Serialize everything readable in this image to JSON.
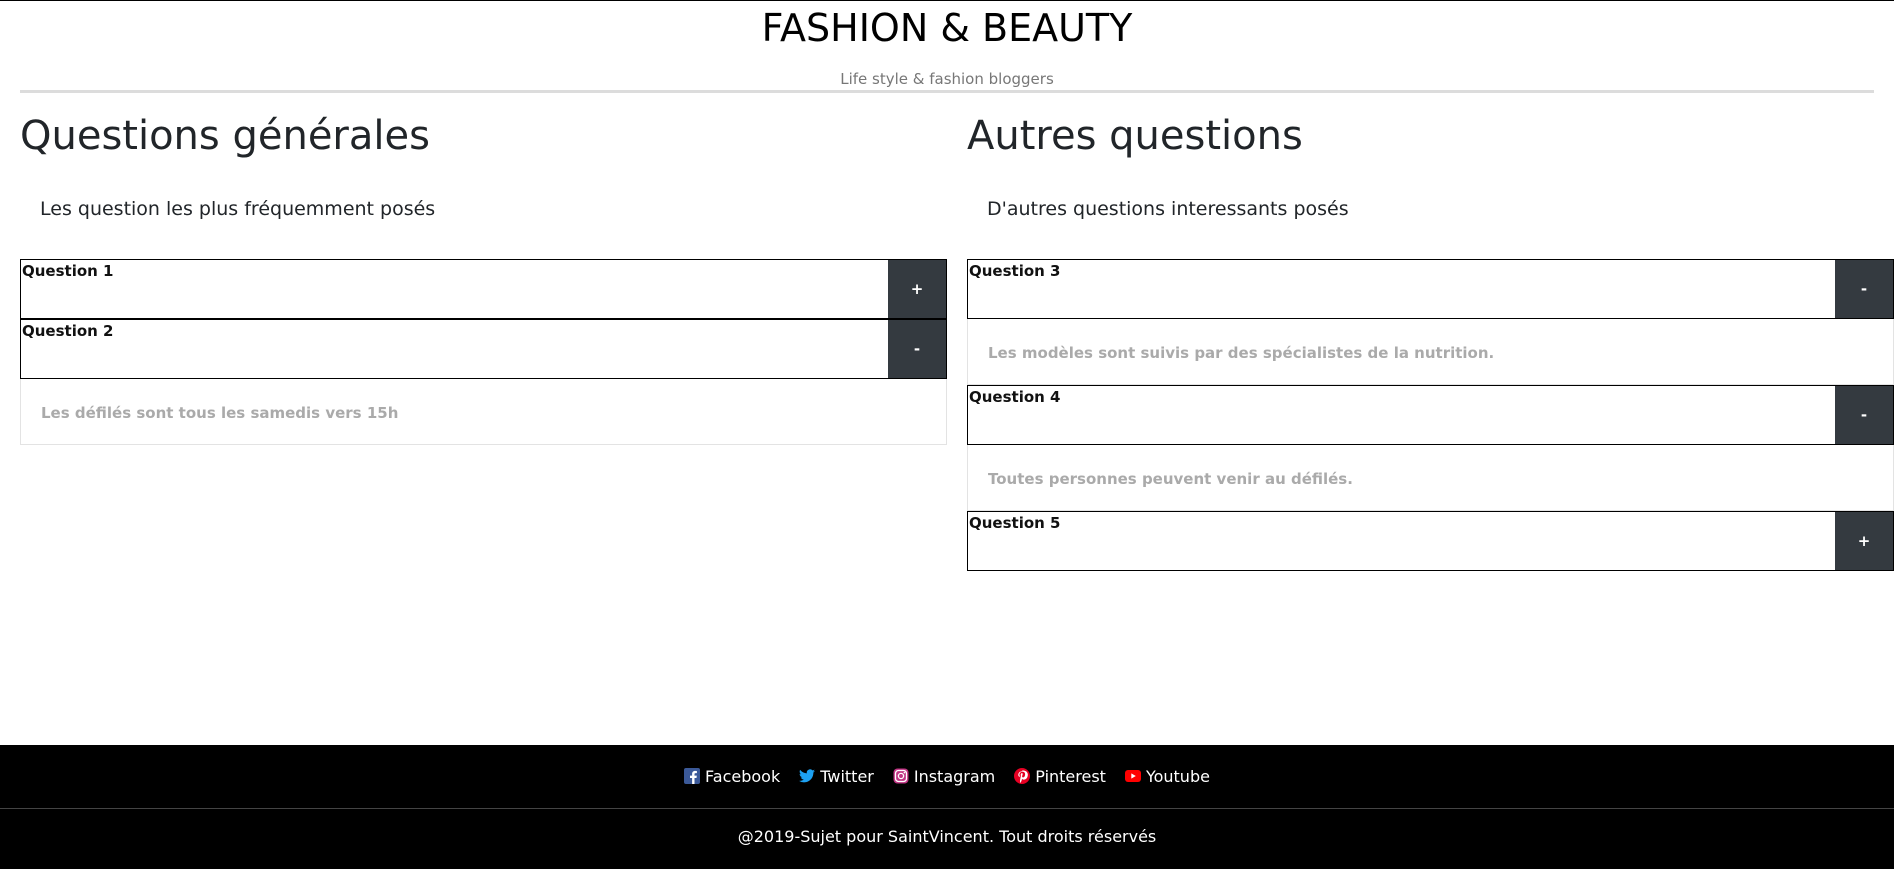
{
  "header": {
    "title": "FASHION & BEAUTY",
    "tagline": "Life style & fashion bloggers"
  },
  "left": {
    "title": "Questions générales",
    "subtitle": "Les question les plus fréquemment posés",
    "items": [
      {
        "label": "Question 1",
        "toggle": "+",
        "answer": ""
      },
      {
        "label": "Question 2",
        "toggle": "-",
        "answer": "Les défilés sont tous les samedis vers 15h"
      }
    ]
  },
  "right": {
    "title": "Autres questions",
    "subtitle": "D'autres questions interessants posés",
    "items": [
      {
        "label": "Question 3",
        "toggle": "-",
        "answer": "Les modèles sont suivis par des spécialistes de la nutrition."
      },
      {
        "label": "Question 4",
        "toggle": "-",
        "answer": "Toutes personnes peuvent venir au défilés."
      },
      {
        "label": "Question 5",
        "toggle": "+",
        "answer": ""
      }
    ]
  },
  "footer": {
    "social": [
      {
        "label": "Facebook",
        "icon": "facebook-icon",
        "color": "#3b5998"
      },
      {
        "label": "Twitter",
        "icon": "twitter-icon",
        "color": "#1da1f2"
      },
      {
        "label": "Instagram",
        "icon": "instagram-icon",
        "color": "#c13584"
      },
      {
        "label": "Pinterest",
        "icon": "pinterest-icon",
        "color": "#e60023"
      },
      {
        "label": "Youtube",
        "icon": "youtube-icon",
        "color": "#ff0000"
      }
    ],
    "copyright": "@2019-Sujet pour SaintVincent. Tout droits réservés"
  }
}
